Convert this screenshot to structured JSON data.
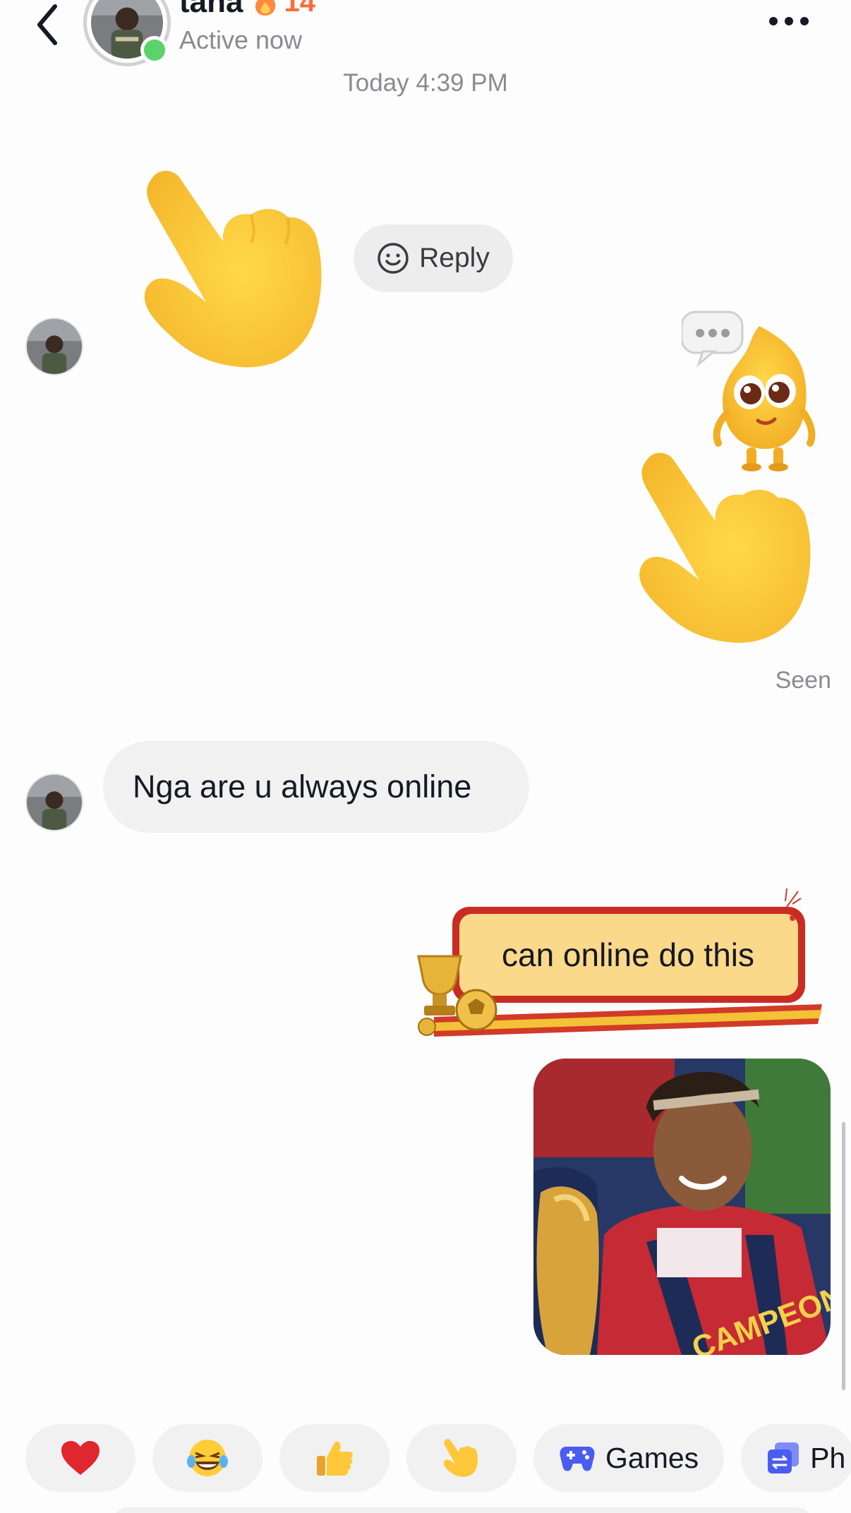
{
  "header": {
    "name": "tana",
    "streak": "14",
    "status": "Active now"
  },
  "timestamp": "Today 4:39 PM",
  "reply_pill": {
    "label": "Reply"
  },
  "seen_label": "Seen",
  "messages": {
    "incoming_text": "Nga are u always online",
    "outgoing_text": "can online do this"
  },
  "photo_caption_text": "CAMPEON",
  "quick_actions": {
    "games": "Games",
    "photos_partial": "Ph"
  },
  "colors": {
    "accent_streak": "#fe6b3a",
    "online": "#5bd26a",
    "bubble_gray": "#f1f1f2",
    "games_icon": "#4b5cf0"
  }
}
